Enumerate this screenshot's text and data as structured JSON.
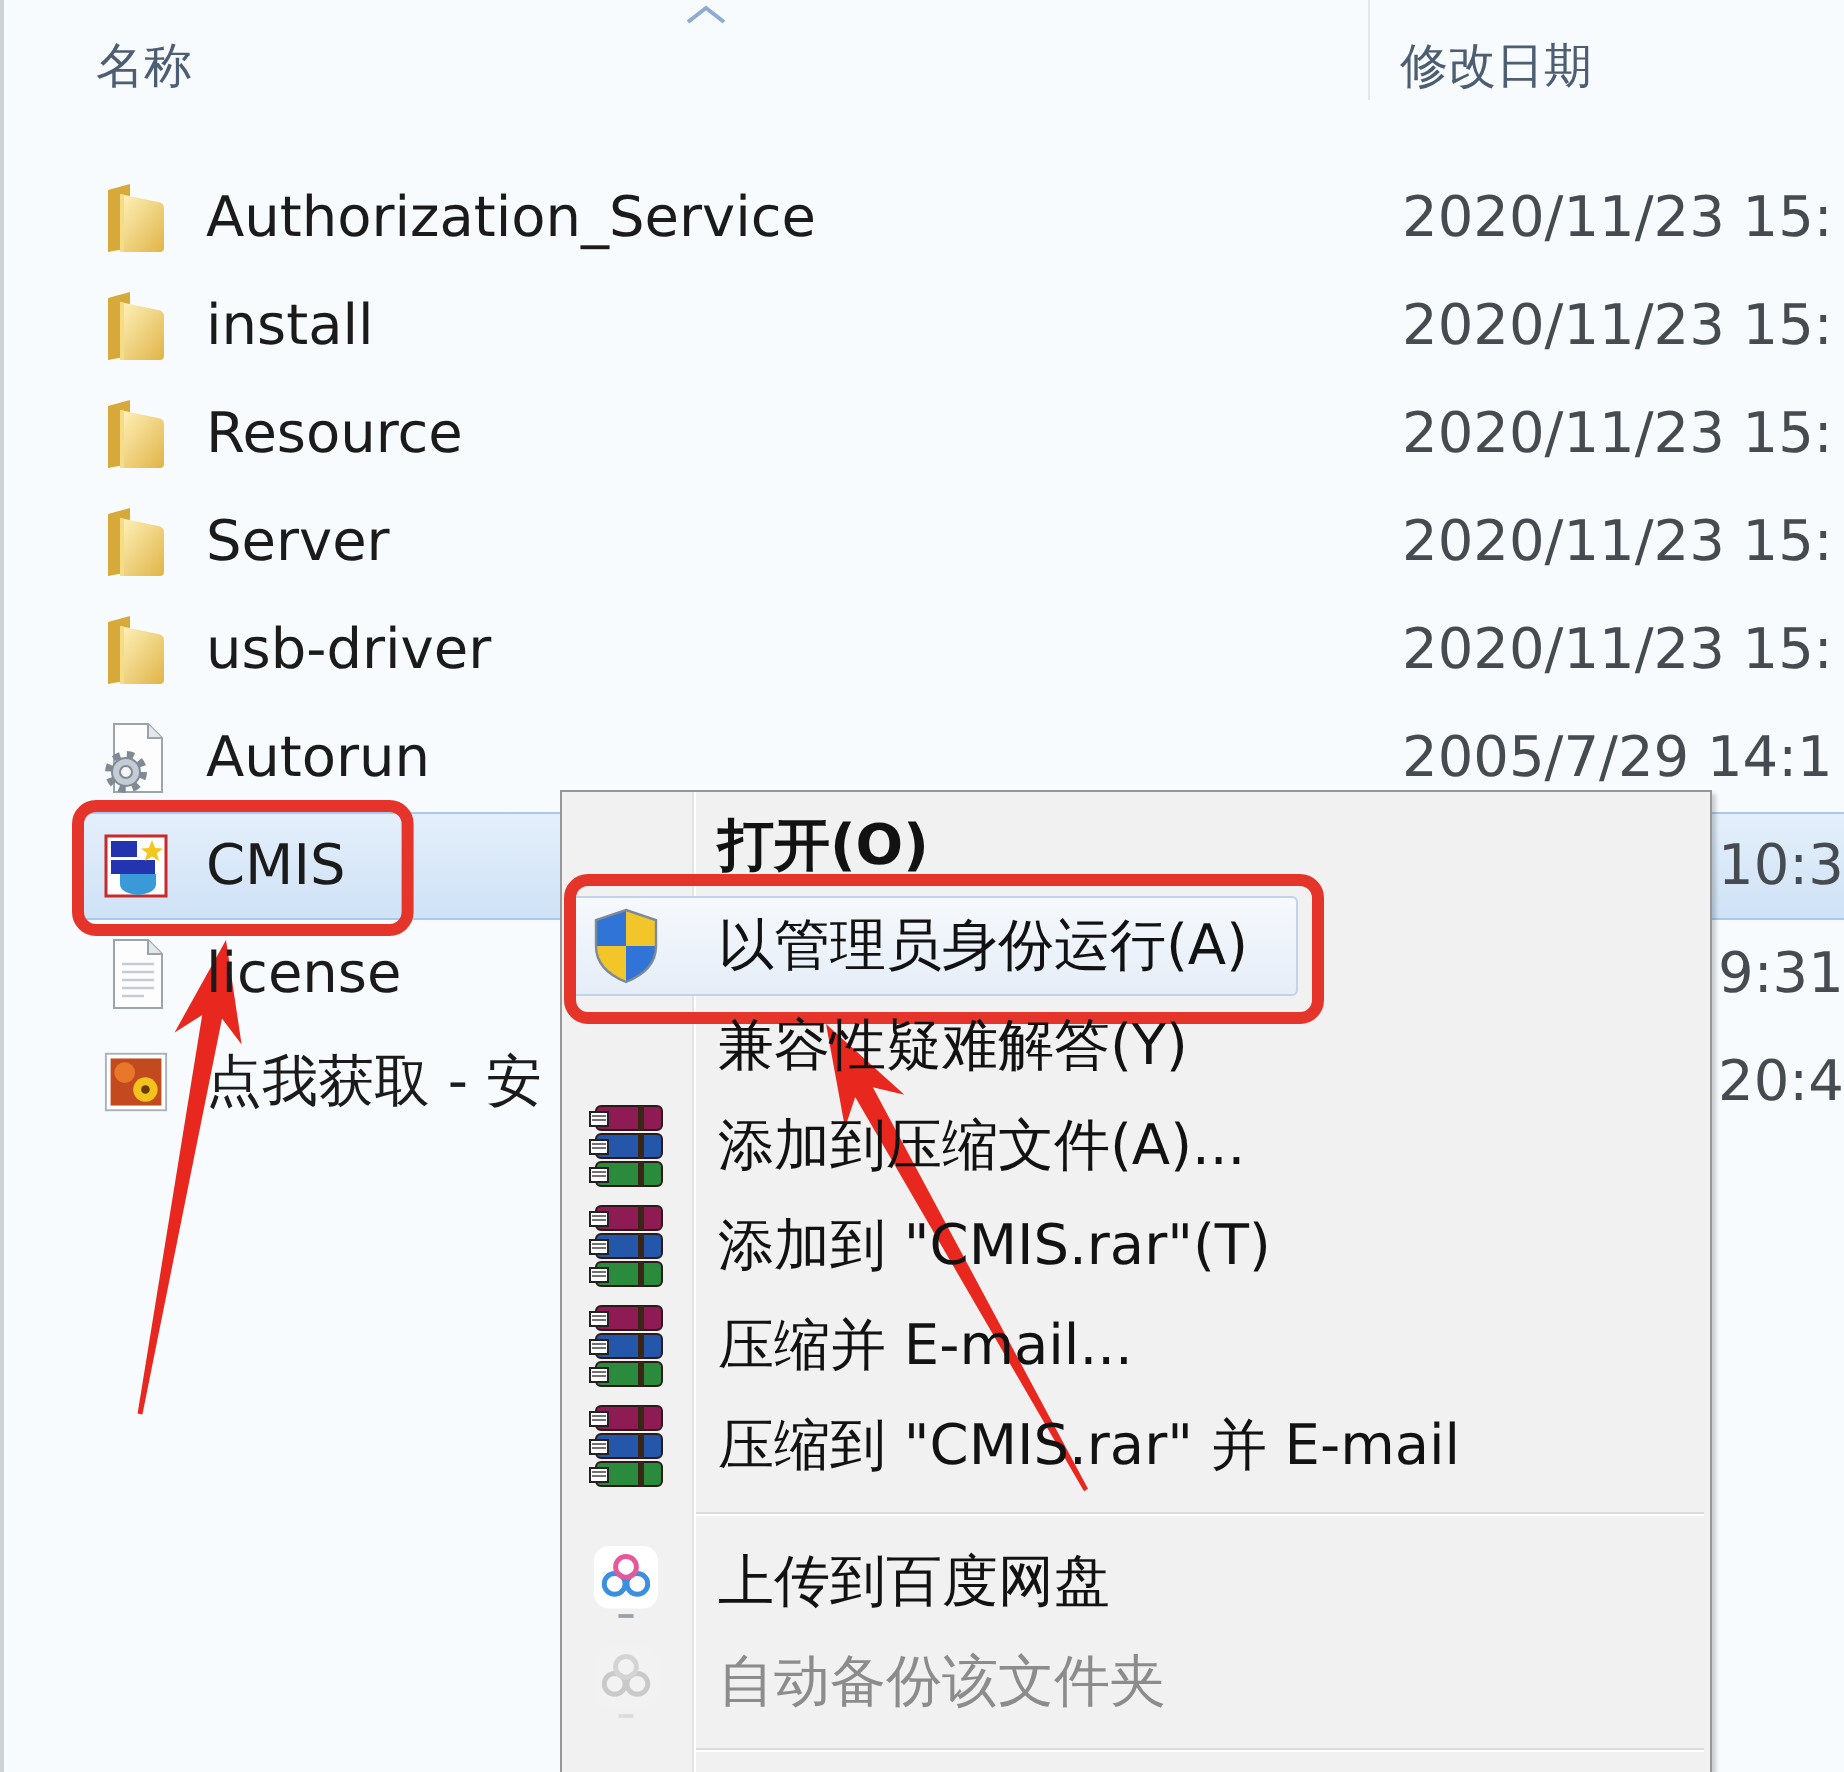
{
  "columns": [
    {
      "label": "名称",
      "sorted": true
    },
    {
      "label": "修改日期",
      "sorted": false
    }
  ],
  "files": [
    {
      "name": "Authorization_Service",
      "kind": "folder",
      "date": "2020/11/23 15:",
      "selected": false,
      "callout": false
    },
    {
      "name": "install",
      "kind": "folder",
      "date": "2020/11/23 15:",
      "selected": false,
      "callout": false
    },
    {
      "name": "Resource",
      "kind": "folder",
      "date": "2020/11/23 15:",
      "selected": false,
      "callout": false
    },
    {
      "name": "Server",
      "kind": "folder",
      "date": "2020/11/23 15:",
      "selected": false,
      "callout": false
    },
    {
      "name": "usb-driver",
      "kind": "folder",
      "date": "2020/11/23 15:",
      "selected": false,
      "callout": false
    },
    {
      "name": "Autorun",
      "kind": "settings",
      "date": "2005/7/29 14:1",
      "selected": false,
      "callout": false
    },
    {
      "name": "CMIS",
      "kind": "app",
      "date": "10:3",
      "selected": true,
      "callout": true
    },
    {
      "name": "license",
      "kind": "text",
      "date": "9:31",
      "selected": false,
      "callout": false
    },
    {
      "name": "点我获取 - 安",
      "kind": "image",
      "date": "20:4",
      "selected": false,
      "callout": false
    }
  ],
  "context_menu": {
    "items": [
      {
        "kind": "plain",
        "label": "打开(O)",
        "default": true,
        "selected": false,
        "disabled": false,
        "callout": false
      },
      {
        "kind": "admin",
        "label": "以管理员身份运行(A)",
        "default": false,
        "selected": true,
        "disabled": false,
        "callout": true
      },
      {
        "kind": "plain",
        "label": "兼容性疑难解答(Y)",
        "default": false,
        "selected": false,
        "disabled": false,
        "callout": false
      },
      {
        "kind": "archive",
        "label": "添加到压缩文件(A)...",
        "default": false,
        "selected": false,
        "disabled": false,
        "callout": false
      },
      {
        "kind": "archive",
        "label": "添加到 \"CMIS.rar\"(T)",
        "default": false,
        "selected": false,
        "disabled": false,
        "callout": false
      },
      {
        "kind": "archive",
        "label": "压缩并 E-mail...",
        "default": false,
        "selected": false,
        "disabled": false,
        "callout": false
      },
      {
        "kind": "archive",
        "label": "压缩到 \"CMIS.rar\" 并 E-mail",
        "default": false,
        "selected": false,
        "disabled": false,
        "callout": false
      },
      {
        "kind": "separator"
      },
      {
        "kind": "cloud",
        "label": "上传到百度网盘",
        "default": false,
        "selected": false,
        "disabled": false,
        "callout": false
      },
      {
        "kind": "cloud",
        "label": "自动备份该文件夹",
        "default": false,
        "selected": false,
        "disabled": true,
        "callout": false
      },
      {
        "kind": "separator"
      }
    ]
  }
}
